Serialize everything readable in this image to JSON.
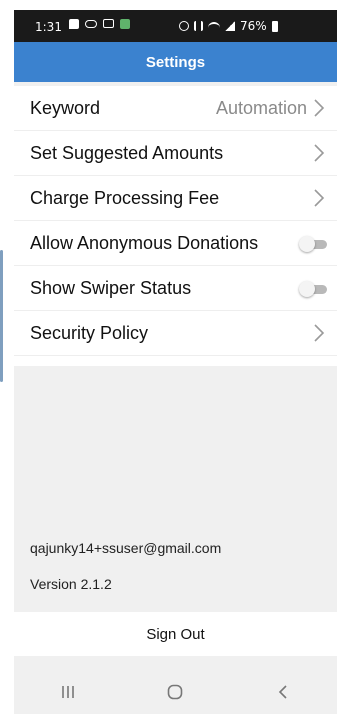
{
  "status_bar": {
    "time": "1:31",
    "battery": "76%",
    "left_icons": [
      "chat-icon",
      "cloud-icon",
      "image-icon",
      "app-notification-icon"
    ],
    "right_icons": [
      "alarm-icon",
      "mute-icon",
      "wifi-icon",
      "signal-icon"
    ]
  },
  "header": {
    "title": "Settings",
    "color": "#3b82cf"
  },
  "settings": {
    "keyword": {
      "label": "Keyword",
      "value": "Automation"
    },
    "suggested_amounts": {
      "label": "Set Suggested Amounts"
    },
    "processing_fee": {
      "label": "Charge Processing Fee"
    },
    "anonymous_donations": {
      "label": "Allow Anonymous Donations",
      "enabled": false
    },
    "swiper_status": {
      "label": "Show Swiper Status",
      "enabled": false
    },
    "security_policy": {
      "label": "Security Policy"
    }
  },
  "account": {
    "email": "qajunky14+ssuser@gmail.com"
  },
  "version": "Version 2.1.2",
  "sign_out": {
    "label": "Sign Out"
  },
  "nav_bar": {
    "icons": [
      "recent-apps-icon",
      "home-icon",
      "back-icon"
    ]
  }
}
